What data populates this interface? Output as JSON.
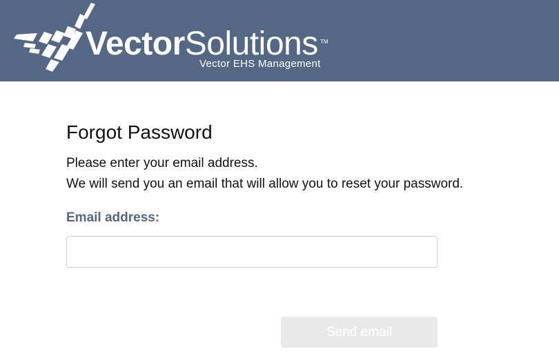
{
  "header": {
    "logo": {
      "brand_bold": "Vector",
      "brand_light": "Solutions",
      "trademark": "TM",
      "subtitle": "Vector EHS Management",
      "icon": "vector-solutions-logo-mark"
    },
    "background_color": "#546785"
  },
  "form": {
    "title": "Forgot Password",
    "instruction_line_1": "Please enter your email address.",
    "instruction_line_2": "We will send you an email that will allow you to reset your password.",
    "email_label": "Email address:",
    "email_value": "",
    "email_placeholder": "",
    "send_button_label": "Send email",
    "send_button_enabled": false
  },
  "colors": {
    "label": "#546785",
    "button_disabled_bg": "#e9e9e9"
  }
}
